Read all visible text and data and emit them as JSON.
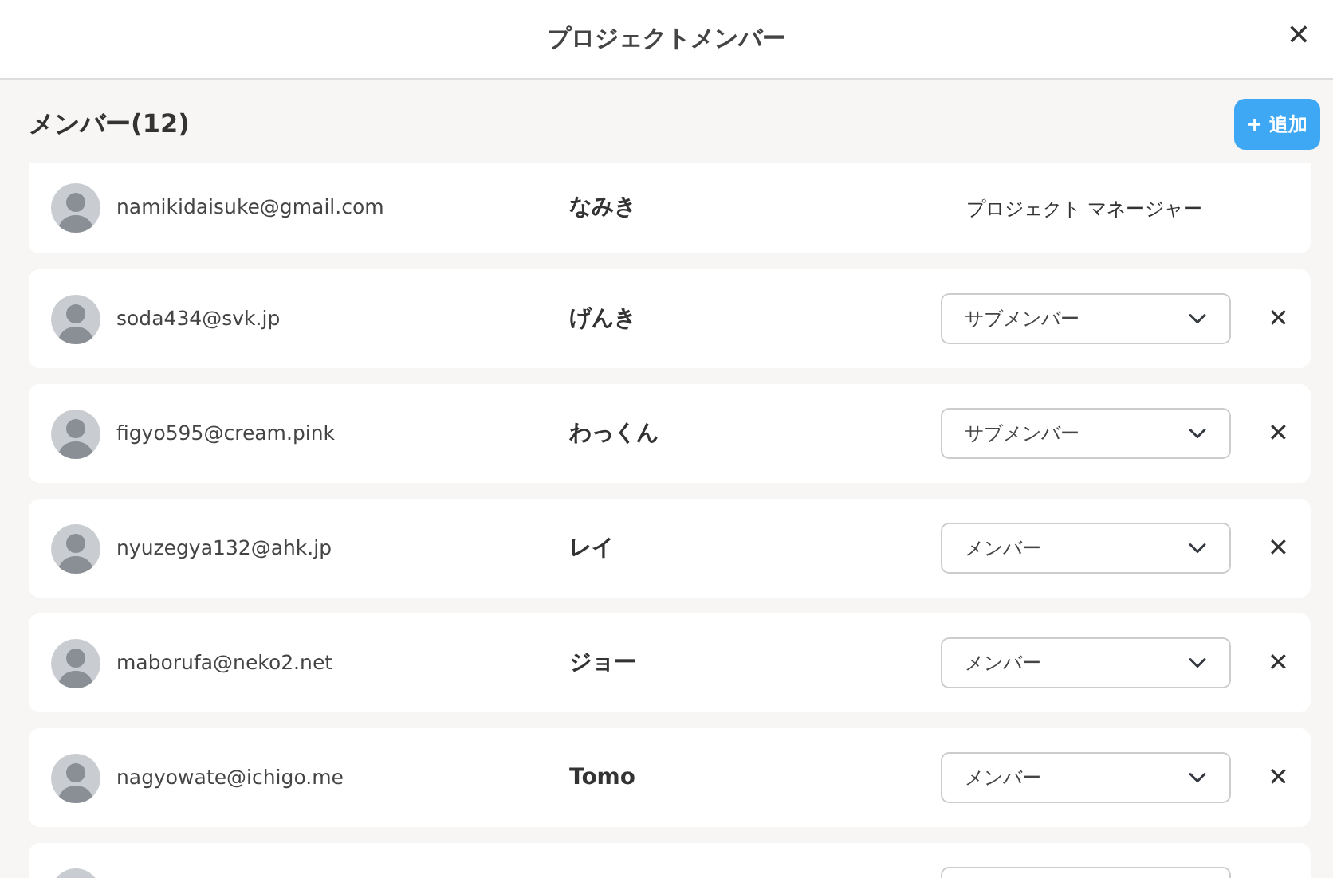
{
  "window": {
    "title": "プロジェクトメンバー",
    "close": "✕"
  },
  "section": {
    "title": "メンバー(12)",
    "add_button": {
      "icon": "+",
      "label": "追加"
    }
  },
  "members": [
    {
      "kind": "fixed",
      "email": "namikidaisuke@gmail.com",
      "name": "なみき",
      "role": "プロジェクト マネージャー"
    },
    {
      "kind": "select",
      "email": "soda434@svk.jp",
      "name": "げんき",
      "role": "サブメンバー",
      "remove": "✕"
    },
    {
      "kind": "select",
      "email": "figyo595@cream.pink",
      "name": "わっくん",
      "role": "サブメンバー",
      "remove": "✕"
    },
    {
      "kind": "select",
      "email": "nyuzegya132@ahk.jp",
      "name": "レイ",
      "role": "メンバー",
      "remove": "✕"
    },
    {
      "kind": "select",
      "email": "maborufa@neko2.net",
      "name": "ジョー",
      "role": "メンバー",
      "remove": "✕"
    },
    {
      "kind": "select",
      "email": "nagyowate@ichigo.me",
      "name": "Tomo",
      "role": "メンバー",
      "remove": "✕"
    },
    {
      "kind": "select"
    }
  ]
}
